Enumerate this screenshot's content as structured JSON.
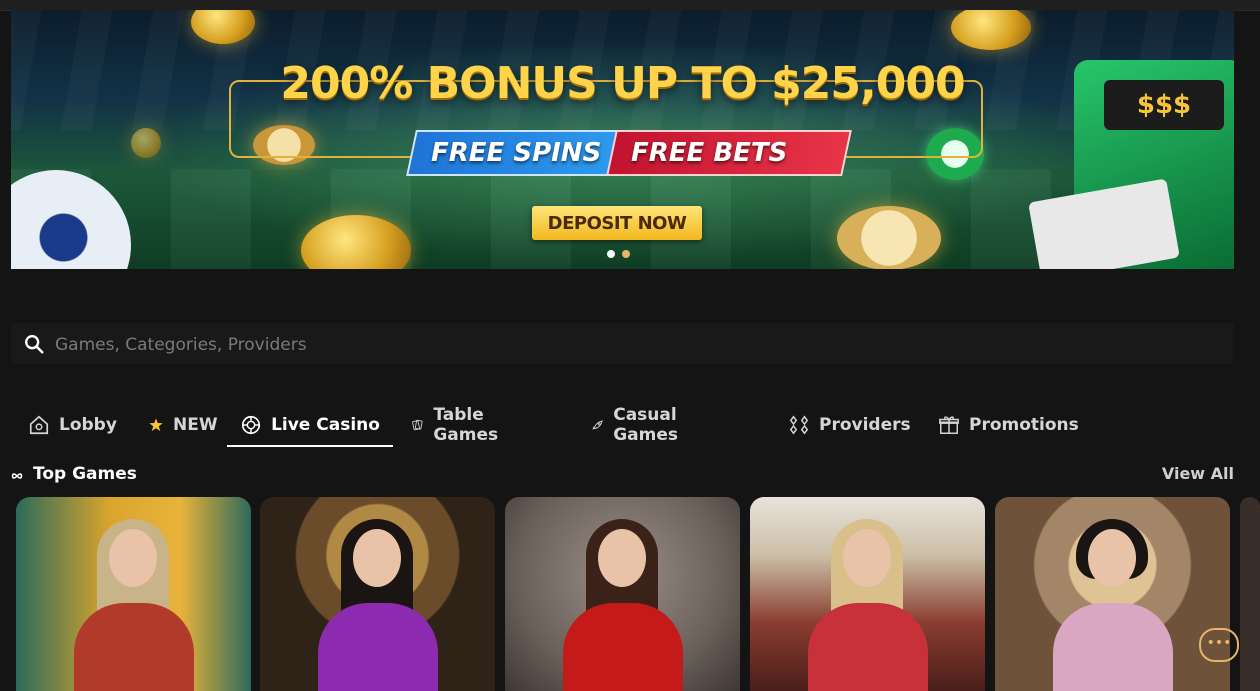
{
  "banner": {
    "headline": "200% BONUS UP TO $25,000",
    "tag_free_spins": "FREE SPINS",
    "tag_free_bets": "FREE BETS",
    "cta": "DEPOSIT NOW",
    "slot_symbols": "$$$",
    "slides": 2,
    "active_slide": 1
  },
  "search": {
    "placeholder": "Games, Categories, Providers",
    "value": ""
  },
  "tabs": [
    {
      "label": "Lobby",
      "icon": "lobby-icon"
    },
    {
      "label": "NEW",
      "icon": "star-icon"
    },
    {
      "label": "Live Casino",
      "icon": "live-casino-icon",
      "active": true
    },
    {
      "label": "Table Games",
      "icon": "cards-icon"
    },
    {
      "label": "Casual Games",
      "icon": "rocket-icon"
    },
    {
      "label": "Providers",
      "icon": "providers-icon"
    },
    {
      "label": "Promotions",
      "icon": "gift-icon"
    }
  ],
  "top_games": {
    "title": "Top Games",
    "view_all": "View All",
    "icon": "infinity-icon"
  },
  "games": [
    {
      "name": "live-dealer-card-1",
      "accent": "#e8b33a"
    },
    {
      "name": "live-dealer-card-2",
      "accent": "#8c2bb0"
    },
    {
      "name": "live-dealer-card-3",
      "accent": "#c41a1a"
    },
    {
      "name": "live-dealer-card-4",
      "accent": "#c8313a"
    },
    {
      "name": "live-dealer-card-5",
      "accent": "#d9a7c2"
    }
  ],
  "colors": {
    "background": "#141414",
    "accent_gold": "#ffd34a",
    "chat_accent": "#e7b46a"
  }
}
